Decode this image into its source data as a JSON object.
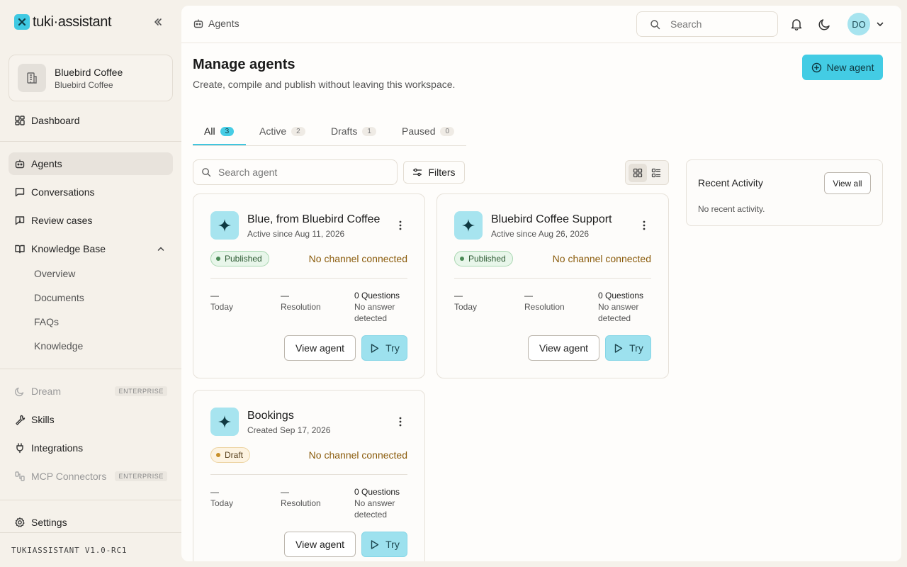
{
  "app": {
    "logo_text": "tuki·assistant",
    "version": "TUKIASSISTANT V1.0-RC1"
  },
  "workspace": {
    "name": "Bluebird Coffee",
    "subtitle": "Bluebird Coffee"
  },
  "nav": {
    "dashboard": "Dashboard",
    "agents": "Agents",
    "conversations": "Conversations",
    "review_cases": "Review cases",
    "knowledge_base": "Knowledge Base",
    "kb_items": [
      "Overview",
      "Documents",
      "FAQs",
      "Knowledge"
    ],
    "dream": "Dream",
    "skills": "Skills",
    "integrations": "Integrations",
    "mcp_connectors": "MCP Connectors",
    "settings": "Settings",
    "enterprise_badge": "ENTERPRISE"
  },
  "topbar": {
    "breadcrumb": "Agents",
    "search_placeholder": "Search",
    "avatar_initials": "DO"
  },
  "page": {
    "title": "Manage agents",
    "subtitle": "Create, compile and publish without leaving this workspace.",
    "new_agent_label": "New agent"
  },
  "tabs": [
    {
      "label": "All",
      "count": "3"
    },
    {
      "label": "Active",
      "count": "2"
    },
    {
      "label": "Drafts",
      "count": "1"
    },
    {
      "label": "Paused",
      "count": "0"
    }
  ],
  "toolbar": {
    "search_placeholder": "Search agent",
    "filters_label": "Filters"
  },
  "agents": [
    {
      "name": "Blue, from Bluebird Coffee",
      "since": "Active since Aug 11, 2026",
      "status": "Published",
      "channel": "No channel connected",
      "today_value": "—",
      "today_label": "Today",
      "resolution_value": "—",
      "resolution_label": "Resolution",
      "questions": "0 Questions",
      "questions_sub_1": "No answer",
      "questions_sub_2": "detected",
      "view_label": "View agent",
      "try_label": "Try"
    },
    {
      "name": "Bluebird Coffee Support",
      "since": "Active since Aug 26, 2026",
      "status": "Published",
      "channel": "No channel connected",
      "today_value": "—",
      "today_label": "Today",
      "resolution_value": "—",
      "resolution_label": "Resolution",
      "questions": "0 Questions",
      "questions_sub_1": "No answer",
      "questions_sub_2": "detected",
      "view_label": "View agent",
      "try_label": "Try"
    },
    {
      "name": "Bookings",
      "since": "Created Sep 17, 2026",
      "status": "Draft",
      "channel": "No channel connected",
      "today_value": "—",
      "today_label": "Today",
      "resolution_value": "—",
      "resolution_label": "Resolution",
      "questions": "0 Questions",
      "questions_sub_1": "No answer",
      "questions_sub_2": "detected",
      "view_label": "View agent",
      "try_label": "Try"
    }
  ],
  "activity": {
    "title": "Recent Activity",
    "view_all_label": "View all",
    "empty_text": "No recent activity."
  },
  "colors": {
    "accent": "#43cce4",
    "accent_soft": "#a7e4ef",
    "background": "#f5f1ea",
    "warning_text": "#8a5b0b"
  }
}
